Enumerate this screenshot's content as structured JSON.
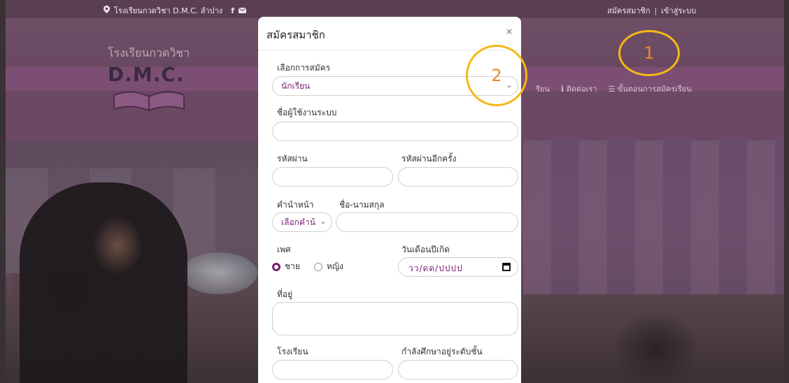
{
  "topbar": {
    "school_label": "โรงเรียนกวดวิชา D.M.C. ลำปาง",
    "register_link": "สมัครสมาชิก",
    "separator": "|",
    "login_link": "เข้าสู่ระบบ",
    "icons": [
      "map-marker-icon",
      "facebook-icon",
      "envelope-icon"
    ]
  },
  "logo": {
    "line1": "โรงเรียนกวดวิชา",
    "line2": "D.M.C."
  },
  "nav": {
    "items": [
      "รียน",
      "ติดต่อเรา",
      "ขั้นตอนการสมัครเรียน"
    ]
  },
  "modal": {
    "title": "สมัครสมาชิก",
    "close": "×",
    "register_type_label": "เลือกการสมัคร",
    "register_type_value": "นักเรียน",
    "username_label": "ชื่อผู้ใช้งานระบบ",
    "password_label": "รหัสผ่าน",
    "password_confirm_label": "รหัสผ่านอีกครั้ง",
    "prefix_label": "คำนำหน้า",
    "prefix_value": "เลือกคำน้",
    "fullname_label": "ชื่อ-นามสกุล",
    "gender_label": "เพศ",
    "gender_options": [
      "ชาย",
      "หญิง"
    ],
    "birthdate_label": "วันเดือนปีเกิด",
    "birthdate_placeholder": "วว/ดด/ปปปป",
    "address_label": "ที่อยู่",
    "school_label": "โรงเรียน",
    "grade_label": "กำลังศึกษาอยู่ระดับชั้น"
  },
  "annotations": [
    "1",
    "2"
  ],
  "colors": {
    "accent": "#7b1f74",
    "annotation": "#f5b814",
    "topbar": "#5a3f53"
  }
}
